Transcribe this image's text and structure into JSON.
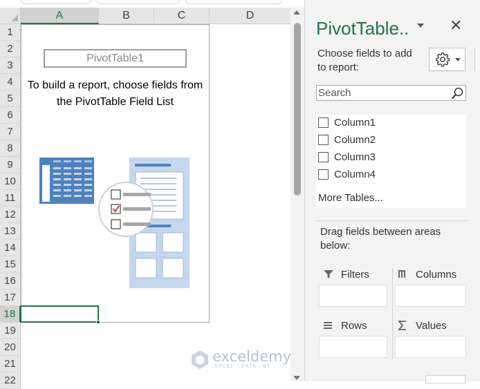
{
  "sheet": {
    "columns": [
      {
        "label": "A",
        "selected": true
      },
      {
        "label": "B",
        "selected": false
      },
      {
        "label": "C",
        "selected": false
      },
      {
        "label": "D",
        "selected": false
      }
    ],
    "rows": [
      "1",
      "2",
      "3",
      "4",
      "5",
      "6",
      "7",
      "8",
      "9",
      "10",
      "11",
      "12",
      "13",
      "14",
      "15",
      "16",
      "17",
      "18",
      "19",
      "20",
      "21",
      "22"
    ],
    "selected_row": "18",
    "active_cell": "A18",
    "pivot": {
      "name": "PivotTable1",
      "message_line1": "To build a report, choose fields from",
      "message_line2": "the PivotTable Field List"
    },
    "watermark": {
      "name": "exceldemy",
      "tagline": "EXCEL · DATA · BI"
    }
  },
  "pane": {
    "title": "PivotTable..",
    "choose_label_line1": "Choose fields to add",
    "choose_label_line2": "to report:",
    "search_placeholder": "Search",
    "fields": [
      {
        "label": "Column1",
        "checked": false
      },
      {
        "label": "Column2",
        "checked": false
      },
      {
        "label": "Column3",
        "checked": false
      },
      {
        "label": "Column4",
        "checked": false
      }
    ],
    "more_tables": "More Tables...",
    "drag_label_line1": "Drag fields between areas",
    "drag_label_line2": "below:",
    "areas": {
      "filters": "Filters",
      "columns": "Columns",
      "rows": "Rows",
      "values": "Values"
    }
  },
  "colors": {
    "accent": "#217346",
    "illustration_blue": "#4f81bd",
    "illustration_light": "#c5d7ec",
    "check_red": "#c0504d"
  },
  "icons": [
    "gear-icon",
    "close-icon",
    "search-icon",
    "filter-icon",
    "columns-icon",
    "rows-icon",
    "sigma-icon"
  ]
}
